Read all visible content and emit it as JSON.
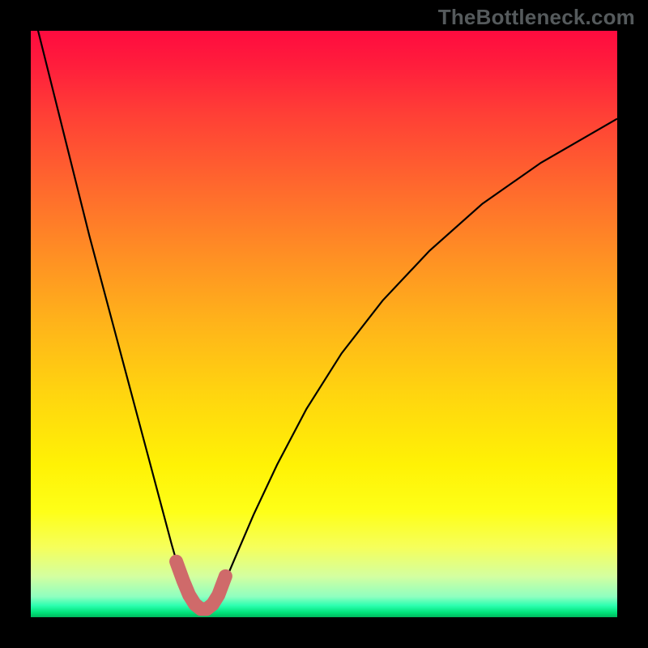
{
  "watermark": "TheBottleneck.com",
  "chart_data": {
    "type": "line",
    "title": "",
    "xlabel": "",
    "ylabel": "",
    "xlim": [
      0,
      100
    ],
    "ylim": [
      0,
      100
    ],
    "grid": false,
    "legend": false,
    "series": [
      {
        "name": "bottleneck-curve",
        "color": "#000000",
        "stroke_width": 2.2,
        "x": [
          0,
          2,
          4,
          6,
          8,
          10,
          12,
          14,
          16,
          18,
          20,
          22,
          24,
          25,
          26,
          27,
          28,
          29,
          30,
          31,
          32,
          33,
          35,
          38,
          42,
          47,
          53,
          60,
          68,
          77,
          87,
          100
        ],
        "y": [
          105,
          97,
          89,
          81,
          73,
          65,
          57.5,
          50,
          42.5,
          35,
          27.5,
          20,
          12.5,
          9,
          6,
          3.6,
          2,
          1.2,
          1.2,
          2,
          3.6,
          5.8,
          10.5,
          17.5,
          26,
          35.5,
          45,
          54,
          62.5,
          70.5,
          77.5,
          85
        ]
      },
      {
        "name": "bottleneck-highlight",
        "color": "#cf6a6a",
        "stroke_width": 17,
        "linecap": "round",
        "x": [
          24.8,
          26,
          27,
          28,
          29,
          30,
          31,
          32,
          33.2
        ],
        "y": [
          9.5,
          6.2,
          3.8,
          2.2,
          1.4,
          1.4,
          2.2,
          3.8,
          7.0
        ]
      }
    ]
  }
}
